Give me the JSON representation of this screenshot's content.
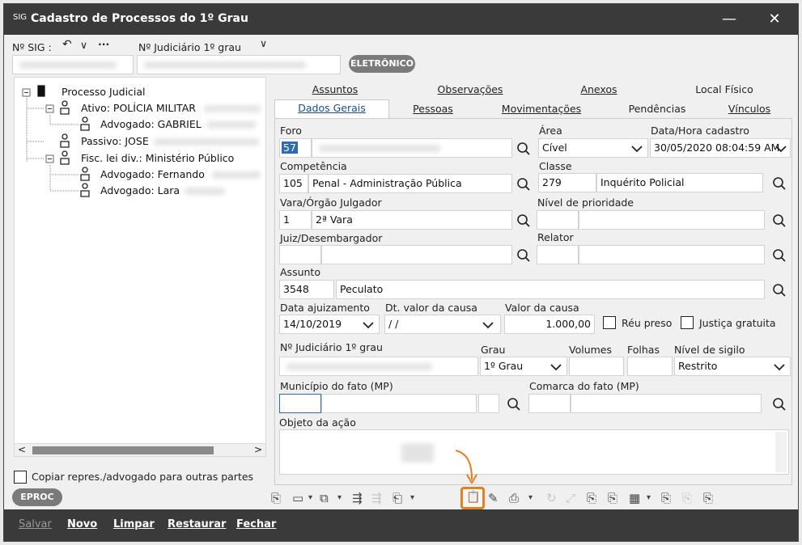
{
  "window": {
    "title": "Cadastro de Processos do 1º Grau",
    "minimize_glyph": "—",
    "close_glyph": "✕",
    "app_icon_text": "SIG"
  },
  "header": {
    "sig_label": "Nº SIG :",
    "back_glyph": "↶",
    "dropdown_glyph": "∨",
    "more_glyph": "···",
    "judicial_label": "Nº Judiciário   1º grau",
    "judicial_dropdown_glyph": "∨",
    "badge": "ELETRÔNICO"
  },
  "tree": {
    "root": "Processo Judicial",
    "nodes": [
      {
        "label": "Ativo: POLÍCIA MILITAR"
      },
      {
        "label": "Advogado: GABRIEL"
      },
      {
        "label": "Passivo: JOSE"
      },
      {
        "label": "Fisc. lei div.: Ministério Público"
      },
      {
        "label": "Advogado: Fernando"
      },
      {
        "label": "Advogado: Lara"
      }
    ],
    "scroll_left": "<",
    "scroll_right": ">",
    "copy_checkbox_label": "Copiar repres./advogado para outras partes"
  },
  "eproc_button": "EPROC",
  "tabs_row1": [
    "Assuntos",
    "Observações",
    "Anexos",
    "Local Físico"
  ],
  "tabs_row2": [
    "Dados Gerais",
    "Pessoas",
    "Movimentações",
    "Pendências",
    "Vínculos"
  ],
  "form": {
    "foro_label": "Foro",
    "foro_code": "57",
    "area_label": "Área",
    "area_value": "Cível",
    "data_cadastro_label": "Data/Hora cadastro",
    "data_cadastro_value": "30/05/2020 08:04:59 AM",
    "competencia_label": "Competência",
    "competencia_code": "105",
    "competencia_value": "Penal - Administração Pública",
    "classe_label": "Classe",
    "classe_code": "279",
    "classe_value": "Inquérito Policial",
    "vara_label": "Vara/Órgão Julgador",
    "vara_code": "1",
    "vara_value": "2ª Vara",
    "prioridade_label": "Nível de prioridade",
    "juiz_label": "Juiz/Desembargador",
    "relator_label": "Relator",
    "assunto_label": "Assunto",
    "assunto_code": "3548",
    "assunto_value": "Peculato",
    "data_ajuizamento_label": "Data ajuizamento",
    "data_ajuizamento_value": "14/10/2019",
    "dt_valor_label": "Dt. valor da causa",
    "dt_valor_value": " /  /",
    "valor_label": "Valor da causa",
    "valor_value": "1.000,00",
    "reu_preso_label": "Réu preso",
    "justica_label": "Justiça gratuita",
    "nj_label": "Nº Judiciário   1º grau",
    "grau_label": "Grau",
    "grau_value": "1º Grau",
    "volumes_label": "Volumes",
    "folhas_label": "Folhas",
    "sigilo_label": "Nível de sigilo",
    "sigilo_value": "Restrito",
    "municipio_label": "Município do fato (MP)",
    "comarca_label": "Comarca do fato (MP)",
    "objeto_label": "Objeto da ação"
  },
  "toolbar_glyphs": [
    "⎘",
    "▭",
    "▾",
    "⧉",
    "▾",
    "⇶",
    "⇶",
    "⎗",
    "▾",
    "📋",
    "✎",
    "⎙",
    "▾",
    "↻",
    "⤢",
    "⎘",
    "⎘",
    "▦",
    "▾",
    "⎘",
    "⎘",
    "⎘"
  ],
  "bottom_bar": {
    "salvar": "Salvar",
    "novo": "Novo",
    "limpar": "Limpar",
    "restaurar": "Restaurar",
    "fechar": "Fechar"
  },
  "colors": {
    "titlebar": "#3a3a3a",
    "highlight": "#e67e22",
    "tab_active": "#1a4d8f"
  }
}
